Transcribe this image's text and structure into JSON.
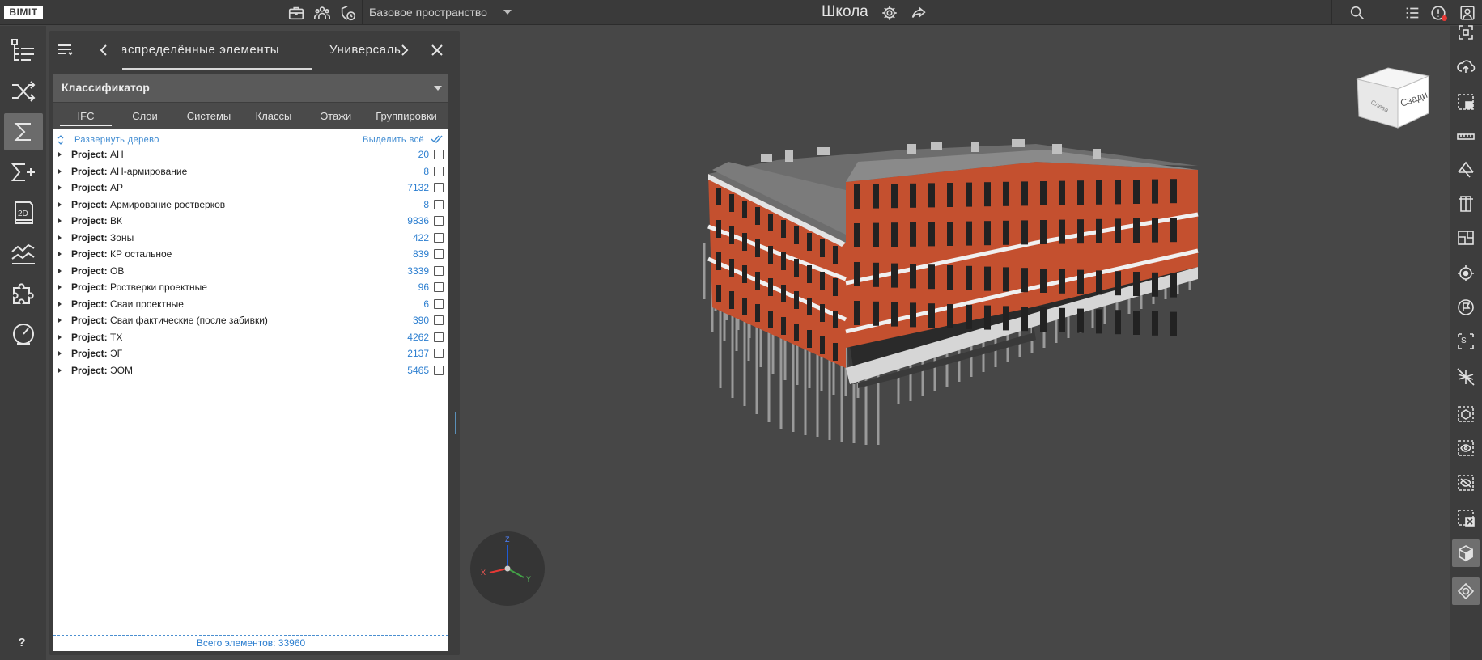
{
  "app": {
    "logo": "BIMIT",
    "space": "Базовое пространство",
    "project_title": "Школа"
  },
  "topbar_icons": [
    "briefcase-icon",
    "team-icon",
    "shield-clock-icon"
  ],
  "topbar_right_icons": [
    "search-icon",
    "list-icon",
    "notifications-icon",
    "account-icon"
  ],
  "left_nav": [
    {
      "name": "model-tree-nav",
      "active": false
    },
    {
      "name": "shuffle-nav",
      "active": false
    },
    {
      "name": "sum-nav",
      "active": true
    },
    {
      "name": "sum-plus-nav",
      "active": false
    },
    {
      "name": "drawing-2d-nav",
      "active": false
    },
    {
      "name": "chart-nav",
      "active": false
    },
    {
      "name": "plugins-nav",
      "active": false
    },
    {
      "name": "dashboard-nav",
      "active": false
    }
  ],
  "help_label": "?",
  "panel": {
    "tabs": [
      "аспределённые элементы",
      "Универсаль"
    ],
    "classifier_label": "Классификатор",
    "subtabs": [
      "IFC",
      "Слои",
      "Системы",
      "Классы",
      "Этажи",
      "Группировки"
    ],
    "expand_tree": "Развернуть дерево",
    "select_all": "Выделить всё",
    "rows": [
      {
        "prefix": "Project:",
        "name": "АН",
        "count": "20"
      },
      {
        "prefix": "Project:",
        "name": "АН-армирование",
        "count": "8"
      },
      {
        "prefix": "Project:",
        "name": "АР",
        "count": "7132"
      },
      {
        "prefix": "Project:",
        "name": "Армирование ростверков",
        "count": "8"
      },
      {
        "prefix": "Project:",
        "name": "ВК",
        "count": "9836"
      },
      {
        "prefix": "Project:",
        "name": "Зоны",
        "count": "422"
      },
      {
        "prefix": "Project:",
        "name": "КР остальное",
        "count": "839"
      },
      {
        "prefix": "Project:",
        "name": "ОВ",
        "count": "3339"
      },
      {
        "prefix": "Project:",
        "name": "Ростверки проектные",
        "count": "96"
      },
      {
        "prefix": "Project:",
        "name": "Сваи проектные",
        "count": "6"
      },
      {
        "prefix": "Project:",
        "name": "Сваи фактические (после забивки)",
        "count": "390"
      },
      {
        "prefix": "Project:",
        "name": "ТХ",
        "count": "4262"
      },
      {
        "prefix": "Project:",
        "name": "ЭГ",
        "count": "2137"
      },
      {
        "prefix": "Project:",
        "name": "ЭОМ",
        "count": "5465"
      }
    ],
    "total": "Всего элементов: 33960"
  },
  "viewcube": {
    "face_label": "Сзади",
    "side_label": "Слева"
  },
  "axes": {
    "x": "X",
    "y": "Y",
    "z": "Z"
  },
  "colors": {
    "facade": "#c4502f",
    "accent_blue": "#2d7fd0",
    "axis_x": "#e53935",
    "axis_y": "#43a047",
    "axis_z": "#1e5bd6"
  },
  "right_tools": [
    "fit-view-icon",
    "cloud-upload-icon",
    "select-box-icon",
    "ruler-icon",
    "section-plane-icon",
    "section-box-icon",
    "floor-plan-icon",
    "target-icon",
    "flag-icon",
    "text-select-icon",
    "hide-grid-icon",
    "isolate-cube-icon",
    "show-icon",
    "hide-icon",
    "clear-selection-icon",
    "shaded-cube-icon",
    "navigation-mode-icon"
  ]
}
